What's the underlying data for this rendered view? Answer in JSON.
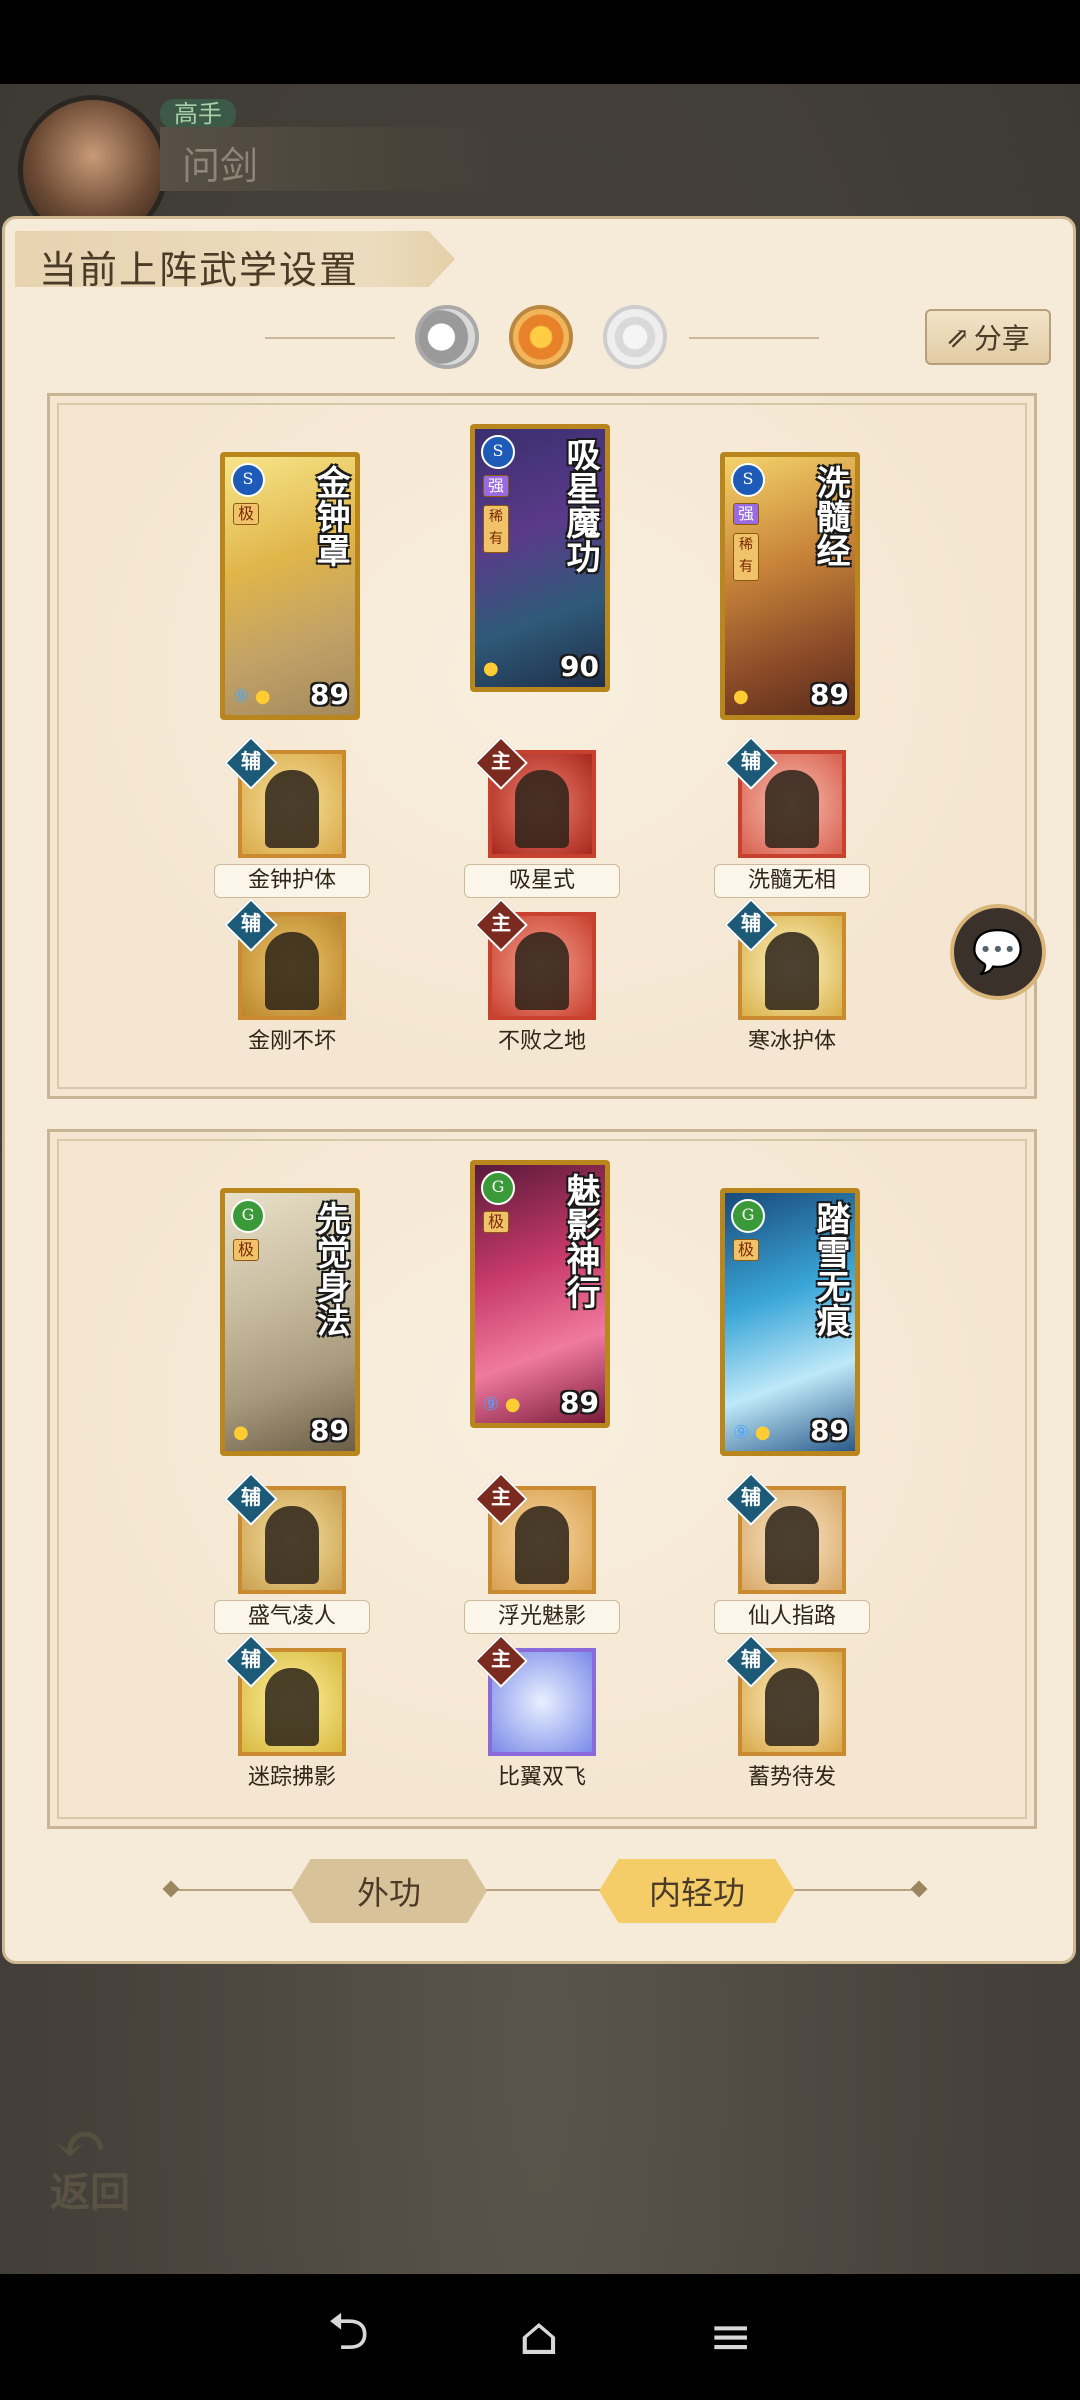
{
  "player": {
    "rank": "高手",
    "name": "问剑"
  },
  "panel": {
    "title": "当前上阵武学设置",
    "share_label": "分享",
    "tabs": [
      {
        "label": "外功"
      },
      {
        "label": "内轻功"
      }
    ]
  },
  "groups": [
    {
      "cards": [
        {
          "name": "金钟罩",
          "score": "89",
          "school": "S",
          "tags": [
            "极"
          ]
        },
        {
          "name": "吸星魔功",
          "score": "90",
          "school": "S",
          "tags": [
            "强",
            "稀有"
          ]
        },
        {
          "name": "洗髓经",
          "score": "89",
          "school": "S",
          "tags": [
            "强",
            "稀有"
          ]
        }
      ],
      "skills_row1": [
        {
          "badge": "辅",
          "label": "金钟护体"
        },
        {
          "badge": "主",
          "label": "吸星式"
        },
        {
          "badge": "辅",
          "label": "洗髓无相"
        }
      ],
      "skills_row2": [
        {
          "badge": "辅",
          "label": "金刚不坏"
        },
        {
          "badge": "主",
          "label": "不败之地"
        },
        {
          "badge": "辅",
          "label": "寒冰护体"
        }
      ]
    },
    {
      "cards": [
        {
          "name": "先觉身法",
          "score": "89",
          "school": "G",
          "tags": [
            "极"
          ]
        },
        {
          "name": "魅影神行",
          "score": "89",
          "school": "G",
          "tags": [
            "极"
          ]
        },
        {
          "name": "踏雪无痕",
          "score": "89",
          "school": "G",
          "tags": [
            "极"
          ]
        }
      ],
      "skills_row1": [
        {
          "badge": "辅",
          "label": "盛气凌人"
        },
        {
          "badge": "主",
          "label": "浮光魅影"
        },
        {
          "badge": "辅",
          "label": "仙人指路"
        }
      ],
      "skills_row2": [
        {
          "badge": "辅",
          "label": "迷踪拂影"
        },
        {
          "badge": "主",
          "label": "比翼双飞"
        },
        {
          "badge": "辅",
          "label": "蓄势待发"
        }
      ]
    }
  ],
  "back_label": "返回",
  "icons": {
    "share": "share-icon",
    "chat": "chat-bubble-icon",
    "back": "back-arrow-icon",
    "nav_back": "nav-back-icon",
    "nav_home": "nav-home-icon",
    "nav_menu": "nav-menu-icon"
  },
  "colors": {
    "panel_bg": "#f6ead8",
    "card_border": "#b8861c",
    "badge_aux": "#1d5a78",
    "badge_main": "#7a2a1e"
  }
}
